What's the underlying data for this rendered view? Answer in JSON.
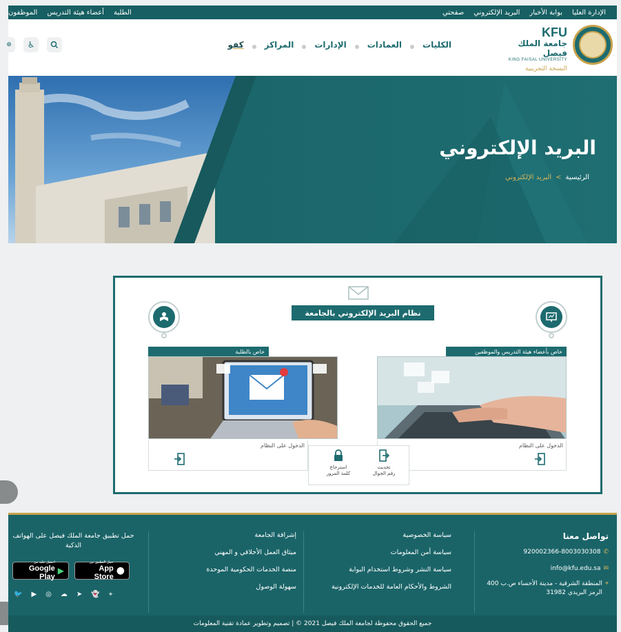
{
  "topbar": {
    "right_links": [
      "الإدارة العليا",
      "بوابة الأخبار",
      "البريد الإلكتروني",
      "صفحتي"
    ],
    "left_links": [
      "الطلبة",
      "أعضاء هيئة التدريس",
      "الموظفون"
    ]
  },
  "logo": {
    "kfu": "KFU",
    "name_ar": "جامعة الملك فيصل",
    "name_en": "KING FAISAL UNIVERSITY",
    "edition": "النسخة التجريبية"
  },
  "nav": {
    "items": [
      "الكليات",
      "العمادات",
      "الإدارات",
      "المراكز",
      "كفو"
    ]
  },
  "hero": {
    "title": "البريد الإلكتروني",
    "breadcrumb_home": "الرئيسية",
    "breadcrumb_sep": ">",
    "breadcrumb_current": "البريد الإلكتروني"
  },
  "card": {
    "system_title": "نظام البريد الإلكتروني بالجامعة",
    "staff_panel_title": "خاص بأعضاء هيئة التدريس والموظفين",
    "students_panel_title": "خاص بالطلبة",
    "staff_login": "الدخول على النظام",
    "students_login": "الدخول على النظام",
    "update_phone": [
      "تحديث",
      "رقم الجوال"
    ],
    "recover_password": [
      "استرجاع",
      "كلمة المرور"
    ]
  },
  "footer": {
    "contact_title": "تواصل معنا",
    "phone": "920002366-8003030308",
    "email": "info@kfu.edu.sa",
    "address_line1": "المنطقة الشرقية - مدينة الأحساء ص.ب 400",
    "address_line2": "الرمز البريدي 31982",
    "col1": [
      "سياسة الخصوصية",
      "سياسة أمن المعلومات",
      "سياسة النشر وشروط استخدام البوابة",
      "الشروط والأحكام العامة للخدمات الإلكترونية"
    ],
    "col2": [
      "إشراقة الجامعة",
      "ميثاق العمل الأخلاقي و المهني",
      "منصة الخدمات الحكومية الموحدة",
      "سهولة الوصول"
    ],
    "app_title": "حمل تطبيق جامعة الملك فيصل على الهواتف الذكية",
    "google_small": "احصل عليه من",
    "google_big": "Google Play",
    "apple_small": "حمل التطبيق من",
    "apple_big": "App Store",
    "copyright": "جميع الحقوق محفوظة لجامعة الملك فيصل 2021 © | تصميم وتطوير عمادة تقنية المعلومات"
  },
  "colors": {
    "primary": "#1d6b6f",
    "gold": "#c7a24a",
    "footer": "#1a6468"
  }
}
